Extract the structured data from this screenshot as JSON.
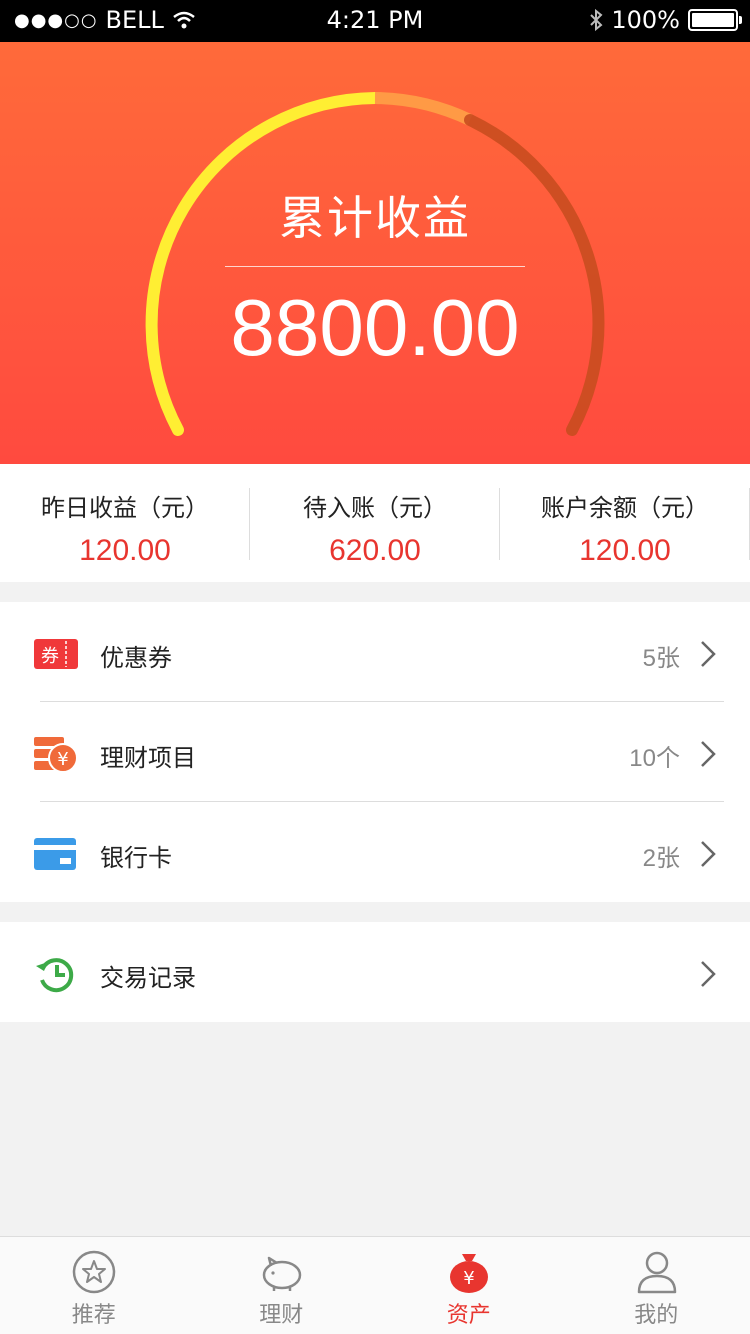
{
  "status_bar": {
    "signal": "●●●○○",
    "carrier": "BELL",
    "time": "4:21 PM",
    "battery": "100%"
  },
  "hero": {
    "title": "累计收益",
    "value": "8800.00",
    "colors": {
      "arc_active": "#ffee33",
      "arc_mid": "#ff9a45",
      "arc_track": "#c94d1f"
    }
  },
  "stats": [
    {
      "label": "昨日收益（元）",
      "value": "120.00"
    },
    {
      "label": "待入账（元）",
      "value": "620.00"
    },
    {
      "label": "账户余额（元）",
      "value": "120.00"
    }
  ],
  "menu": {
    "group1": [
      {
        "icon": "coupon-icon",
        "icon_text": "券",
        "title": "优惠券",
        "count": "5张"
      },
      {
        "icon": "finance-project-icon",
        "icon_text": "¥",
        "title": "理财项目",
        "count": "10个"
      },
      {
        "icon": "bank-card-icon",
        "title": "银行卡",
        "count": "2张"
      }
    ],
    "group2": [
      {
        "icon": "history-icon",
        "title": "交易记录",
        "count": ""
      }
    ]
  },
  "tabs": [
    {
      "icon": "star-icon",
      "label": "推荐",
      "active": false
    },
    {
      "icon": "piggy-bank-icon",
      "label": "理财",
      "active": false
    },
    {
      "icon": "money-bag-icon",
      "icon_text": "¥",
      "label": "资产",
      "active": true
    },
    {
      "icon": "user-icon",
      "label": "我的",
      "active": false
    }
  ],
  "accent_color": "#e8352f"
}
